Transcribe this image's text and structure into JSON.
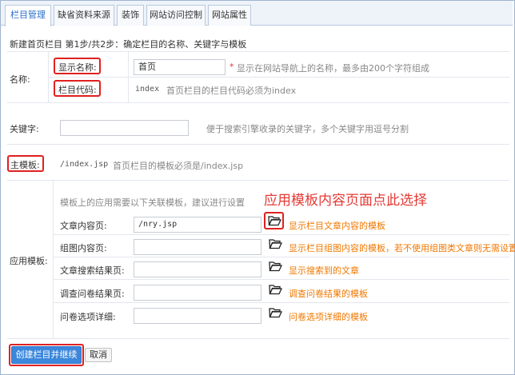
{
  "tabs": [
    {
      "label": "栏目管理"
    },
    {
      "label": "缺省资料来源"
    },
    {
      "label": "装饰"
    },
    {
      "label": "网站访问控制"
    },
    {
      "label": "网站属性"
    }
  ],
  "step_text": "新建首页栏目  第1步/共2步：确定栏目的名称、关键字与模板",
  "name_section": {
    "group_label": "名称:",
    "display_name_label": "显示名称:",
    "display_name_value": "首页",
    "display_name_required": "*",
    "display_name_hint": "显示在网站导航上的名称，最多由200个字符组成",
    "code_label": "栏目代码:",
    "code_value": "index",
    "code_hint": "首页栏目的栏目代码必须为index"
  },
  "keyword_section": {
    "label": "关键字:",
    "value": "",
    "hint": "便于搜索引擎收录的关键字，多个关键字用逗号分割"
  },
  "main_template": {
    "label": "主模板:",
    "value": "/index.jsp",
    "hint": "首页栏目的模板必须是/index.jsp"
  },
  "app_templates": {
    "group_label": "应用模板:",
    "note": "模板上的应用需要以下关联模板，建议进行设置",
    "annotation": "应用模板内容页面点此选择",
    "rows": [
      {
        "label": "文章内容页:",
        "value": "/nry.jsp",
        "hint": "显示栏目文章内容的模板",
        "icon": "folder-open-icon"
      },
      {
        "label": "组图内容页:",
        "value": "",
        "hint": "显示栏目组图内容的模板，若不使用组图类文章则无需设置",
        "icon": "folder-open-icon"
      },
      {
        "label": "文章搜索结果页:",
        "value": "",
        "hint": "显示搜索到的文章",
        "icon": "folder-open-icon"
      },
      {
        "label": "调查问卷结果页:",
        "value": "",
        "hint": "调查问卷结果的模板",
        "icon": "folder-open-icon"
      },
      {
        "label": "问卷选项详细:",
        "value": "",
        "hint": "问卷选项详细的模板",
        "icon": "folder-open-icon"
      }
    ]
  },
  "buttons": {
    "create": "创建栏目并继续",
    "cancel": "取消"
  },
  "colors": {
    "accent": "#3a87dc",
    "highlight_box": "#e02020",
    "hint_orange": "#f07800",
    "annotation": "#e53935"
  }
}
